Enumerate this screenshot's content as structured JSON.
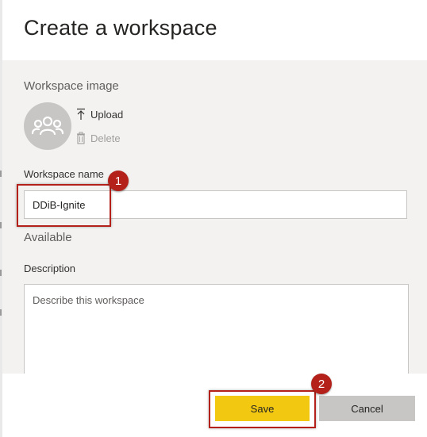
{
  "dialog": {
    "title": "Create a workspace"
  },
  "workspace_image": {
    "section_label": "Workspace image",
    "avatar_icon": "group-people-icon",
    "upload_label": "Upload",
    "upload_icon": "upload-arrow-icon",
    "delete_label": "Delete",
    "delete_icon": "trash-icon"
  },
  "workspace_name": {
    "label": "Workspace name",
    "value": "DDiB-Ignite",
    "availability": "Available"
  },
  "description": {
    "label": "Description",
    "placeholder": "Describe this workspace",
    "value": ""
  },
  "footer": {
    "save_label": "Save",
    "cancel_label": "Cancel"
  },
  "annotations": {
    "callout_1": "1",
    "callout_2": "2"
  },
  "colors": {
    "save_button": "#f2c811",
    "cancel_button": "#c8c6c4",
    "annotation_red": "#b4211b",
    "body_background": "#f3f2f1"
  }
}
